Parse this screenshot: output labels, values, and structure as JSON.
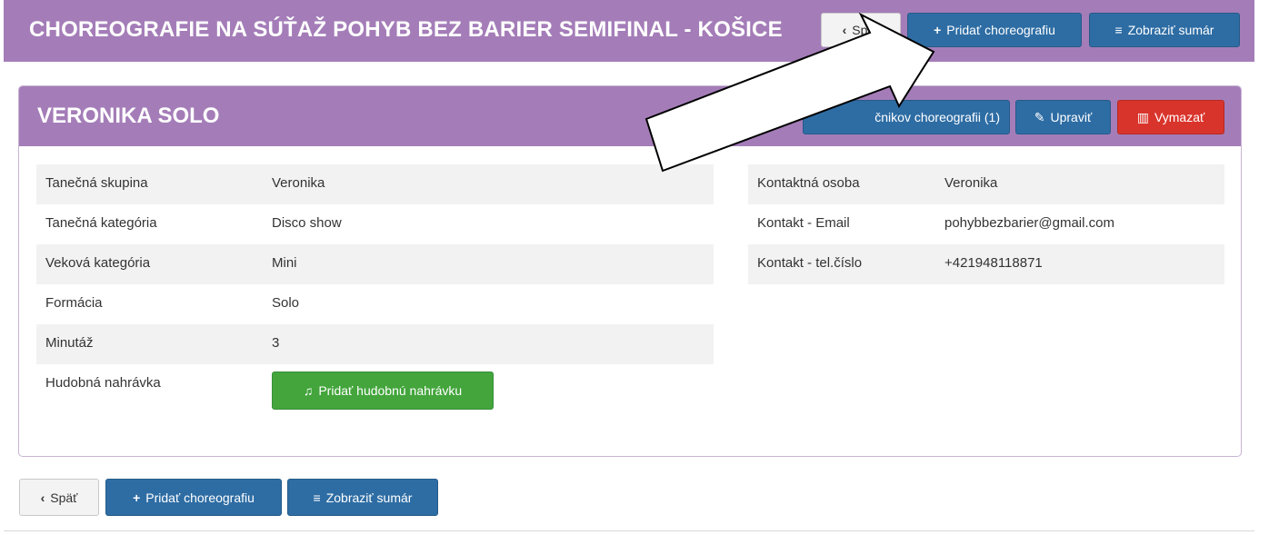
{
  "header": {
    "title": "CHOREOGRAFIE NA SÚŤAŽ POHYB BEZ BARIER SEMIFINAL - KOŠICE",
    "back_label": "Späť",
    "add_label": "Pridať choreografiu",
    "summary_label": "Zobraziť sumár"
  },
  "card": {
    "title": "VERONIKA SOLO",
    "participants_label": "Účastníkov choreografii (1)",
    "participants_visible_text": "čnikov choreografii (1)",
    "edit_label": "Upraviť",
    "delete_label": "Vymazať",
    "left_rows": [
      {
        "label": "Tanečná skupina",
        "value": "Veronika"
      },
      {
        "label": "Tanečná kategória",
        "value": "Disco show"
      },
      {
        "label": "Veková kategória",
        "value": "Mini"
      },
      {
        "label": "Formácia",
        "value": "Solo"
      },
      {
        "label": "Minutáž",
        "value": "3"
      },
      {
        "label": "Hudobná nahrávka",
        "value": ""
      }
    ],
    "music_button_label": "Pridať hudobnú nahrávku",
    "right_rows": [
      {
        "label": "Kontaktná osoba",
        "value": "Veronika"
      },
      {
        "label": "Kontakt - Email",
        "value": "pohybbezbarier@gmail.com"
      },
      {
        "label": "Kontakt - tel.číslo",
        "value": "+421948118871"
      }
    ]
  },
  "footer": {
    "back_label": "Späť",
    "add_label": "Pridať choreografiu",
    "summary_label": "Zobraziť sumár"
  },
  "icons": {
    "back": "chevron-left-icon",
    "add": "plus-icon",
    "summary": "list-icon",
    "edit": "pencil-icon",
    "delete": "trash-icon",
    "music": "music-note-icon"
  },
  "colors": {
    "header_bg": "#a47db8",
    "primary": "#2e6da4",
    "danger": "#d9342b",
    "success": "#43a53c"
  }
}
